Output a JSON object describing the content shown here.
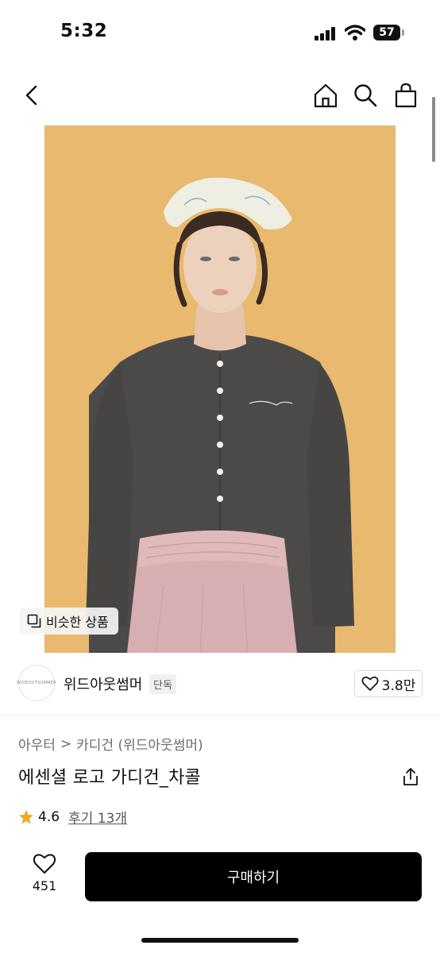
{
  "status_bar": {
    "time": "5:32",
    "battery": "57"
  },
  "image": {
    "similar_label": "비슷한 상품"
  },
  "brand": {
    "logo_text": "WIDEOUTSUMMER",
    "name": "위드아웃썸머",
    "badge": "단독",
    "likes": "3.8만"
  },
  "breadcrumb": {
    "category": "아우터",
    "separator": ">",
    "subcategory": "카디건 (위드아웃썸머)"
  },
  "product": {
    "title": "에센셜 로고 가디건_차콜",
    "rating": "4.6",
    "reviews": "후기 13개"
  },
  "bottom_bar": {
    "wish_count": "451",
    "buy_label": "구매하기"
  },
  "colors": {
    "accent": "#000000",
    "star": "#f5a623",
    "image_bg": "#e8b96e"
  }
}
